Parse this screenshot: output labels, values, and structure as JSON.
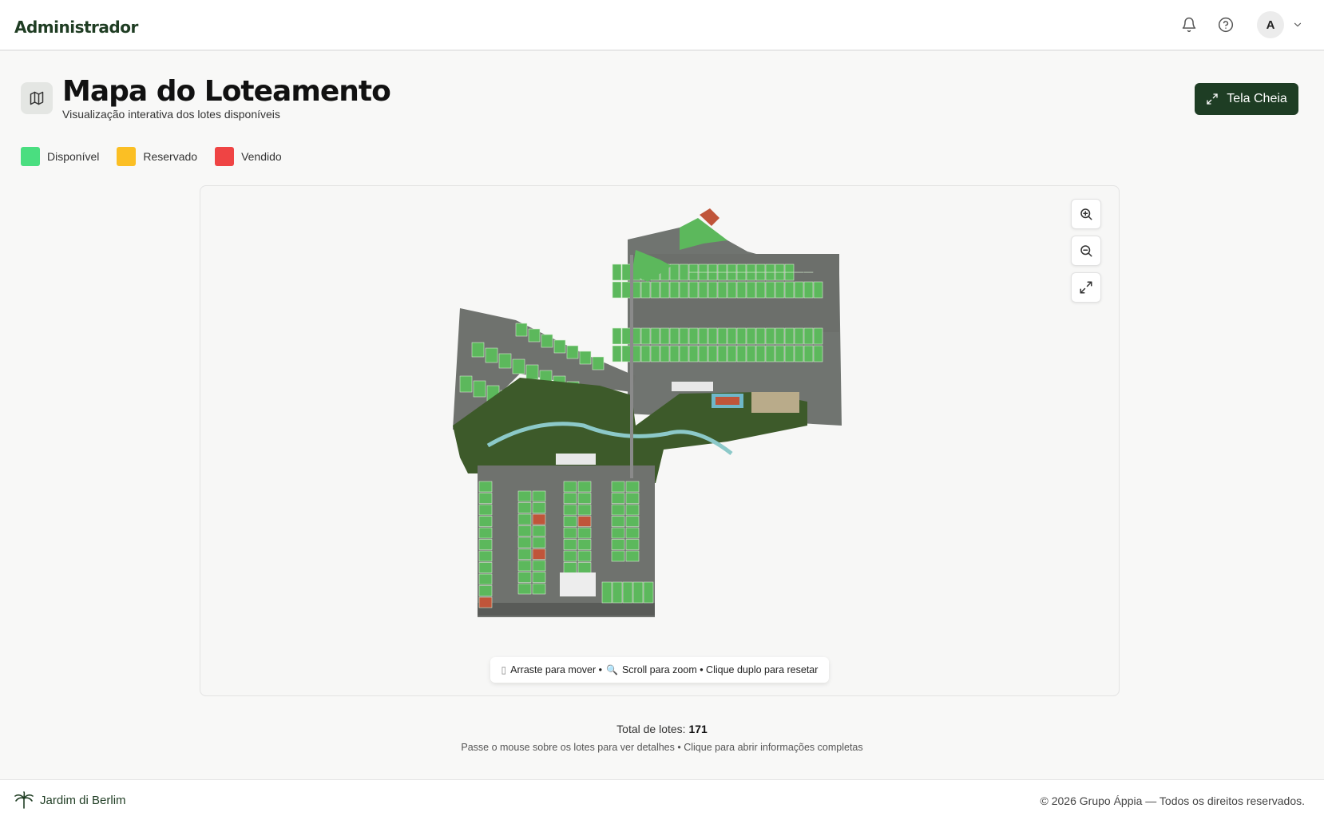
{
  "header": {
    "brand": "Administrador",
    "avatar_initial": "A",
    "icons": [
      "bell-icon",
      "help-icon",
      "chevron-down-icon"
    ]
  },
  "page": {
    "title": "Mapa do Loteamento",
    "subtitle": "Visualização interativa dos lotes disponíveis",
    "fullscreen_label": "Tela Cheia",
    "title_icon": "map-icon"
  },
  "legend": [
    {
      "label": "Disponível",
      "color": "#4ade80"
    },
    {
      "label": "Reservado",
      "color": "#fbbf24"
    },
    {
      "label": "Vendido",
      "color": "#ef4444"
    }
  ],
  "map": {
    "controls": [
      "zoom-in-icon",
      "zoom-out-icon",
      "expand-icon"
    ],
    "hint_drag": "Arraste para mover •",
    "hint_zoom": "Scroll para zoom • Clique duplo para resetar",
    "colors": {
      "lot": "#5cb85c",
      "sold": "#c0553a",
      "road": "#8a8a8a",
      "green": "#3d5a2a"
    }
  },
  "summary": {
    "total_label": "Total de lotes:",
    "total_value": "171",
    "help_text": "Passe o mouse sobre os lotes para ver detalhes • Clique para abrir informações completas"
  },
  "footer": {
    "brand": "Jardim di Berlim",
    "copyright": "© 2026 Grupo Áppia — Todos os direitos reservados."
  }
}
